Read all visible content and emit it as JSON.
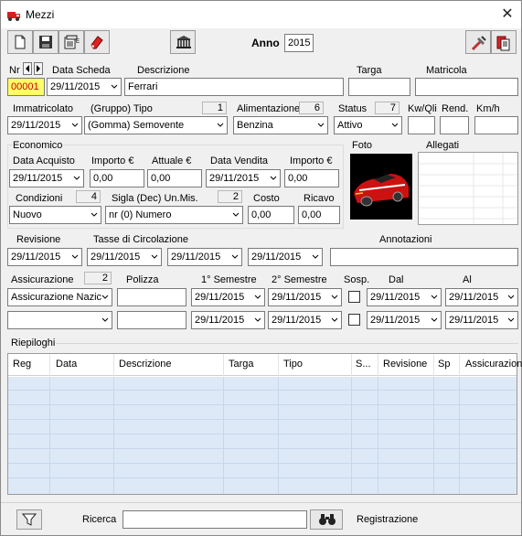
{
  "window": {
    "title": "Mezzi",
    "close": "✕"
  },
  "toolbar": {
    "anno_label": "Anno",
    "anno_value": "2015"
  },
  "header": {
    "nr_label": "Nr",
    "nr_value": "00001",
    "data_scheda_label": "Data Scheda",
    "data_scheda_value": "29/11/2015",
    "descrizione_label": "Descrizione",
    "descrizione_value": "Ferrari",
    "targa_label": "Targa",
    "targa_value": "",
    "matricola_label": "Matricola",
    "matricola_value": ""
  },
  "row2": {
    "immatricolato_label": "Immatricolato",
    "immatricolato_value": "29/11/2015",
    "tipo_label": "(Gruppo) Tipo",
    "tipo_count": "1",
    "tipo_value": "(Gomma) Semovente",
    "alimentazione_label": "Alimentazione",
    "alimentazione_count": "6",
    "alimentazione_value": "Benzina",
    "status_label": "Status",
    "status_count": "7",
    "status_value": "Attivo",
    "kw_label": "Kw/Qli",
    "kw_value": "",
    "rend_label": "Rend.",
    "rend_value": "",
    "kmh_label": "Km/h",
    "kmh_value": ""
  },
  "economico": {
    "group_label": "Economico",
    "data_acquisto_label": "Data Acquisto",
    "data_acquisto_value": "29/11/2015",
    "importo_label": "Importo €",
    "importo_value": "0,00",
    "attuale_label": "Attuale €",
    "attuale_value": "0,00",
    "data_vendita_label": "Data Vendita",
    "data_vendita_value": "29/11/2015",
    "importo2_label": "Importo €",
    "importo2_value": "0,00",
    "condizioni_label": "Condizioni",
    "condizioni_count": "4",
    "condizioni_value": "Nuovo",
    "sigla_label": "Sigla (Dec) Un.Mis.",
    "sigla_count": "2",
    "sigla_value": "nr (0) Numero",
    "costo_label": "Costo",
    "costo_value": "0,00",
    "ricavo_label": "Ricavo",
    "ricavo_value": "0,00"
  },
  "foto": {
    "label": "Foto"
  },
  "allegati": {
    "label": "Allegati"
  },
  "revisione": {
    "revisione_label": "Revisione",
    "revisione_value": "29/11/2015",
    "tasse_label": "Tasse di Circolazione",
    "tasse1_value": "29/11/2015",
    "tasse2_value": "29/11/2015",
    "tasse3_value": "29/11/2015",
    "annotazioni_label": "Annotazioni",
    "annotazioni_value": ""
  },
  "assicurazione": {
    "label": "Assicurazione",
    "count": "2",
    "polizza_label": "Polizza",
    "sem1_label": "1° Semestre",
    "sem2_label": "2° Semestre",
    "sosp_label": "Sosp.",
    "dal_label": "Dal",
    "al_label": "Al",
    "row1": {
      "assic": "Assicurazione Nazic",
      "polizza": "",
      "sem1": "29/11/2015",
      "sem2": "29/11/2015",
      "dal": "29/11/2015",
      "al": "29/11/2015"
    },
    "row2": {
      "assic": "",
      "polizza": "",
      "sem1": "29/11/2015",
      "sem2": "29/11/2015",
      "dal": "29/11/2015",
      "al": "29/11/2015"
    }
  },
  "riepiloghi": {
    "label": "Riepiloghi",
    "columns": [
      "Reg",
      "Data",
      "Descrizione",
      "Targa",
      "Tipo",
      "S...",
      "Revisione",
      "Sp",
      "Assicurazion"
    ]
  },
  "footer": {
    "ricerca_label": "Ricerca",
    "ricerca_value": "",
    "registrazione_label": "Registrazione"
  },
  "colors": {
    "nr_highlight": "#ffff66",
    "grid_rows": "#dde9f6",
    "car": "#cc1111"
  }
}
